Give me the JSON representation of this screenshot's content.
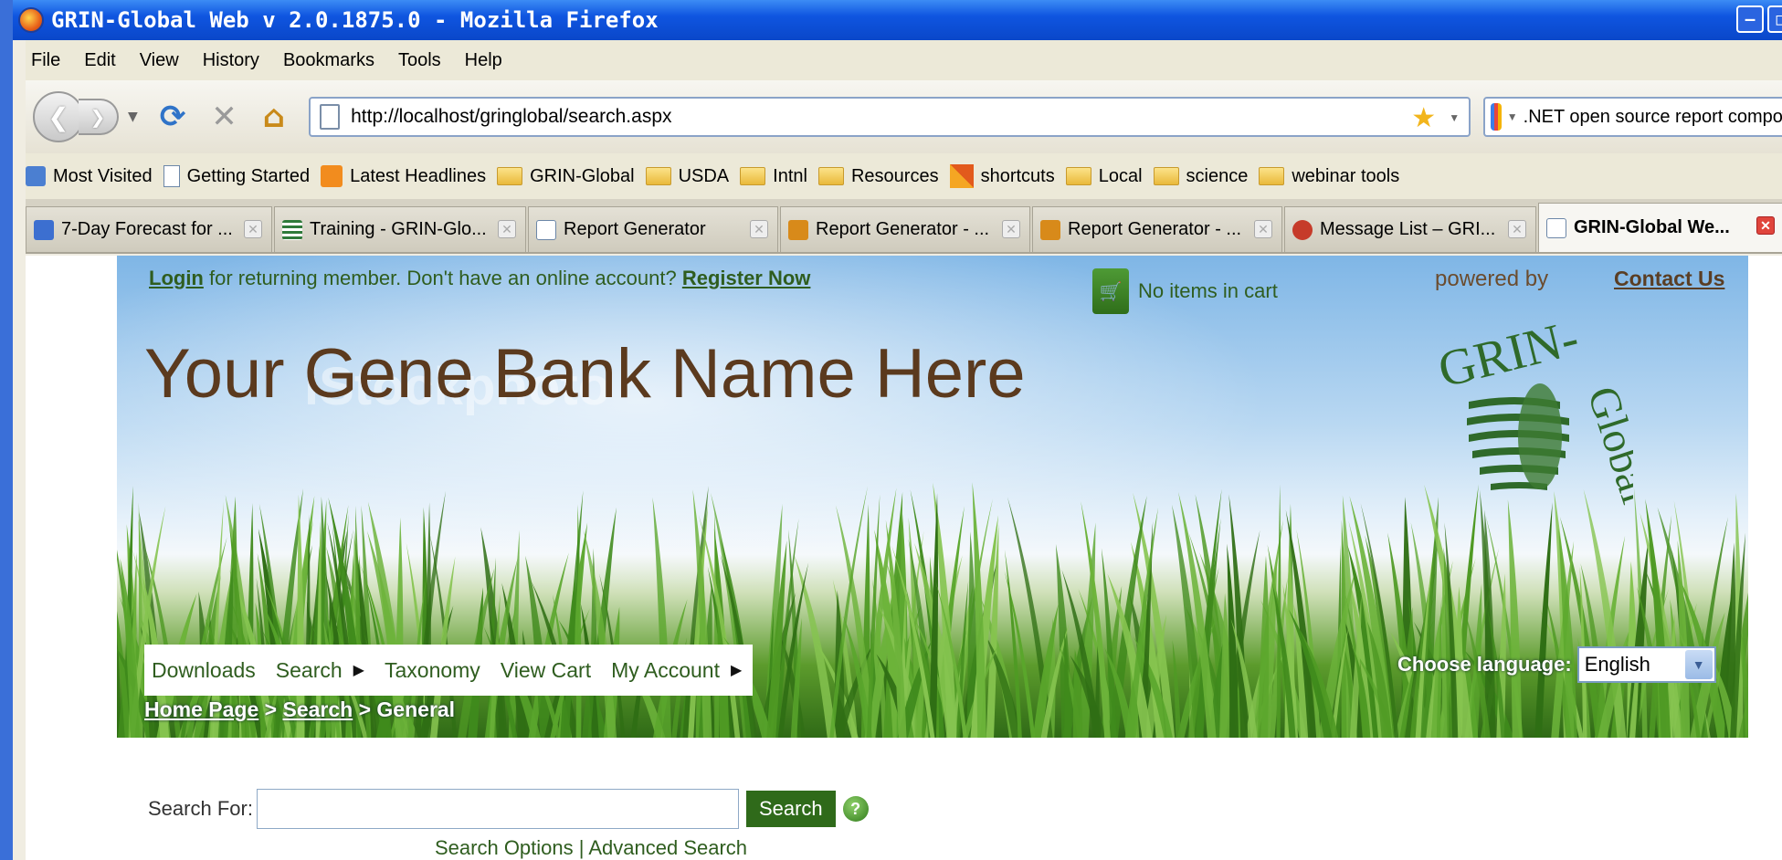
{
  "window": {
    "title": "GRIN-Global Web v 2.0.1875.0 - Mozilla Firefox"
  },
  "menubar": {
    "items": [
      "File",
      "Edit",
      "View",
      "History",
      "Bookmarks",
      "Tools",
      "Help"
    ]
  },
  "nav": {
    "url": "http://localhost/gringlobal/search.aspx",
    "search_engine_text": ".NET open source report compon"
  },
  "bookmarks": {
    "items": [
      "Most Visited",
      "Getting Started",
      "Latest Headlines",
      "GRIN-Global",
      "USDA",
      "Intnl",
      "Resources",
      "shortcuts",
      "Local",
      "science",
      "webinar tools"
    ]
  },
  "tabs": [
    {
      "label": "7-Day Forecast for ...",
      "icon_color": "#3c6fd0"
    },
    {
      "label": "Training - GRIN-Glo...",
      "icon_color": "#2f7a3a"
    },
    {
      "label": "Report Generator",
      "icon_color": "#ffffff"
    },
    {
      "label": "Report Generator - ...",
      "icon_color": "#d88a1a"
    },
    {
      "label": "Report Generator - ...",
      "icon_color": "#d88a1a"
    },
    {
      "label": "Message List – GRI...",
      "icon_color": "#c63b2a"
    },
    {
      "label": "GRIN-Global We...",
      "icon_color": "#ffffff",
      "active": true
    }
  ],
  "header": {
    "login_link": "Login",
    "login_text": " for returning member. Don't have an online account? ",
    "register_link": "Register Now",
    "cart_text": "No items in cart",
    "powered_by": "powered by",
    "contact_link": "Contact Us",
    "bank_name": "Your Gene Bank Name Here",
    "logo_text_top": "GRIN-",
    "logo_text_side": "Global",
    "watermark": "iStockphoto"
  },
  "menu": {
    "downloads": "Downloads",
    "search": "Search",
    "taxonomy": "Taxonomy",
    "view_cart": "View Cart",
    "my_account": "My Account"
  },
  "breadcrumb": {
    "home": "Home Page",
    "sep": " > ",
    "search": "Search",
    "current": "General"
  },
  "language": {
    "label": "Choose language:",
    "selected": "English"
  },
  "search": {
    "label": "Search For:",
    "value": "",
    "button": "Search",
    "options_link": "Search Options",
    "divider": " | ",
    "advanced_link": "Advanced Search"
  }
}
